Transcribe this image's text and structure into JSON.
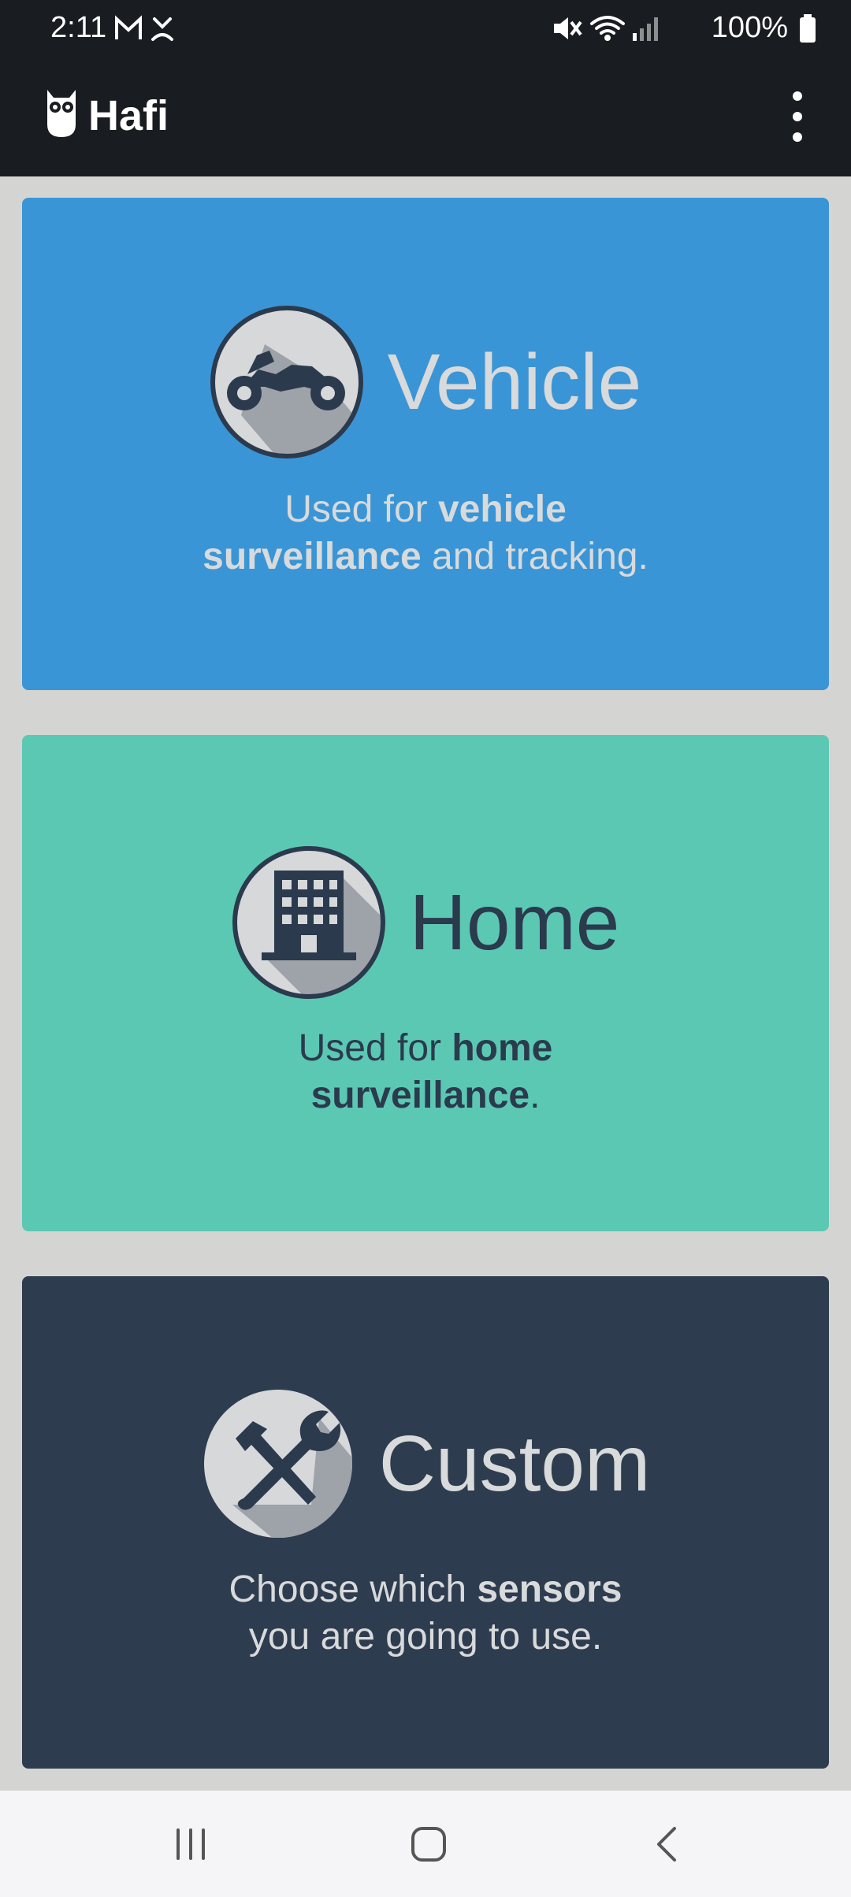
{
  "status_bar": {
    "time": "2:11",
    "battery": "100%"
  },
  "app_bar": {
    "title": "Hafi"
  },
  "cards": [
    {
      "id": "vehicle",
      "title": "Vehicle",
      "icon": "motorcycle-icon",
      "desc_line1_pre": "Used for ",
      "desc_line1_bold": "vehicle",
      "desc_line2_bold": "surveillance",
      "desc_line2_post": " and tracking.",
      "color": "#3a95d6"
    },
    {
      "id": "home",
      "title": "Home",
      "icon": "building-icon",
      "desc_line1_pre": "Used for ",
      "desc_line1_bold": "home",
      "desc_line2_bold": "surveillance",
      "desc_line2_post": ".",
      "color": "#5bc8b4"
    },
    {
      "id": "custom",
      "title": "Custom",
      "icon": "tools-icon",
      "desc_line1_pre": "Choose which ",
      "desc_line1_bold": "sensors",
      "desc_line2_pre": "you are going to use.",
      "color": "#2e3c4f"
    }
  ],
  "nav": {
    "items": [
      "recents-icon",
      "home-icon",
      "back-icon"
    ]
  }
}
